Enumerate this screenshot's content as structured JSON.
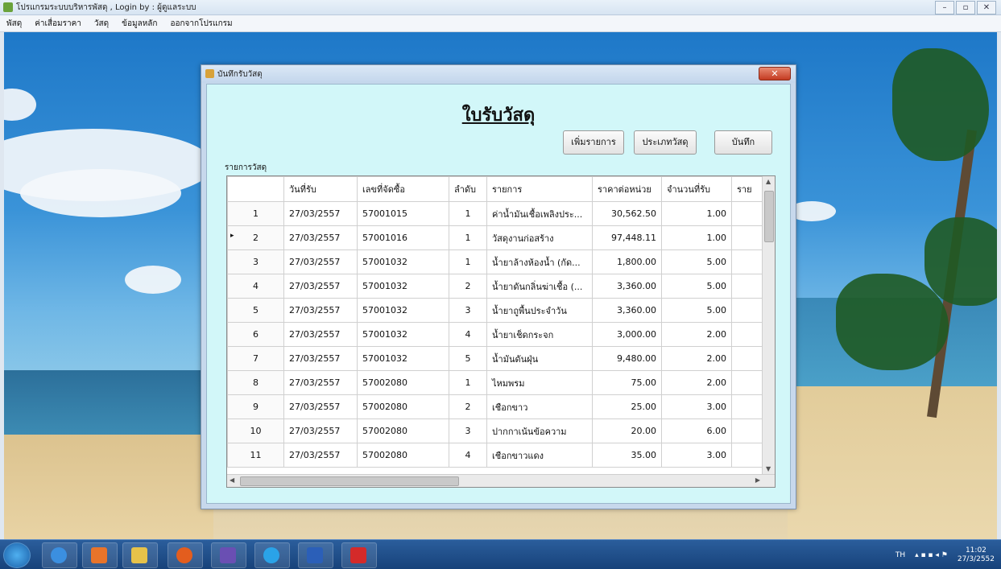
{
  "window": {
    "title": "โปรแกรมระบบบริหารพัสดุ , Login by : ผู้ดูแลระบบ",
    "controls": [
      "–",
      "▫",
      "✕"
    ]
  },
  "menu": [
    "พัสดุ",
    "ค่าเสื่อมราคา",
    "วัสดุ",
    "ข้อมูลหลัก",
    "ออกจากโปรแกรม"
  ],
  "form": {
    "title": "บันทึกรับวัสดุ",
    "close_label": "✕",
    "heading": "ใบรับวัสดุ",
    "buttons": {
      "add": "เพิ่มรายการ",
      "type": "ประเภทวัสดุ",
      "save": "บันทึก"
    },
    "grid_label": "รายการวัสดุ",
    "columns": [
      "",
      "วันที่รับ",
      "เลขที่จัดซื้อ",
      "ลำดับ",
      "รายการ",
      "ราคาต่อหน่วย",
      "จำนวนที่รับ",
      "ราย"
    ],
    "rows": [
      [
        "1",
        "27/03/2557",
        "57001015",
        "1",
        "ค่าน้ำมันเชื้อเพลิงประ...",
        "30,562.50",
        "1.00"
      ],
      [
        "2",
        "27/03/2557",
        "57001016",
        "1",
        "วัสดุงานก่อสร้าง",
        "97,448.11",
        "1.00"
      ],
      [
        "3",
        "27/03/2557",
        "57001032",
        "1",
        "น้ำยาล้างห้องน้ำ (กัด...",
        "1,800.00",
        "5.00"
      ],
      [
        "4",
        "27/03/2557",
        "57001032",
        "2",
        "น้ำยาดันกลิ่นฆ่าเชื้อ (...",
        "3,360.00",
        "5.00"
      ],
      [
        "5",
        "27/03/2557",
        "57001032",
        "3",
        "น้ำยาถูพื้นประจำวัน",
        "3,360.00",
        "5.00"
      ],
      [
        "6",
        "27/03/2557",
        "57001032",
        "4",
        "น้ำยาเช็ดกระจก",
        "3,000.00",
        "2.00"
      ],
      [
        "7",
        "27/03/2557",
        "57001032",
        "5",
        "น้ำมันดันฝุ่น",
        "9,480.00",
        "2.00"
      ],
      [
        "8",
        "27/03/2557",
        "57002080",
        "1",
        "ไหมพรม",
        "75.00",
        "2.00"
      ],
      [
        "9",
        "27/03/2557",
        "57002080",
        "2",
        "เชือกขาว",
        "25.00",
        "3.00"
      ],
      [
        "10",
        "27/03/2557",
        "57002080",
        "3",
        "ปากกาเน้นข้อความ",
        "20.00",
        "6.00"
      ],
      [
        "11",
        "27/03/2557",
        "57002080",
        "4",
        "เชือกขาวแดง",
        "35.00",
        "3.00"
      ]
    ],
    "current_row_marker": "▸"
  },
  "tray": {
    "lang": "TH",
    "time": "11:02",
    "date": "27/3/2552"
  }
}
